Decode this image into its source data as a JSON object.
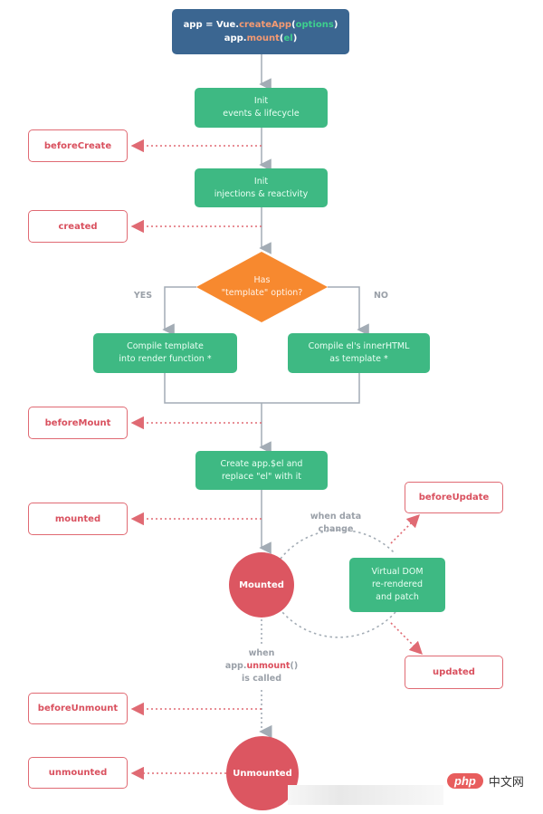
{
  "title": "Vue app lifecycle diagram",
  "colors": {
    "start_box": "#3b6691",
    "process_box": "#3eb983",
    "decision": "#f7892f",
    "hook_border": "#e06a73",
    "hook_text": "#d9505e",
    "state_circle": "#dc5661",
    "flow_line": "#a3acb5",
    "hook_arrow": "#e06a73"
  },
  "start": {
    "line1": {
      "prefix": "app = Vue.",
      "method": "createApp",
      "paren_open": "(",
      "arg": "options",
      "paren_close": ")"
    },
    "line2": {
      "prefix": "app.",
      "method": "mount",
      "paren_open": "(",
      "arg": "el",
      "paren_close": ")"
    }
  },
  "steps": {
    "init_events": [
      "Init",
      "events & lifecycle"
    ],
    "init_injections": [
      "Init",
      "injections & reactivity"
    ],
    "decision": [
      "Has",
      "\"template\" option?"
    ],
    "yes_label": "YES",
    "no_label": "NO",
    "compile_template": [
      "Compile template",
      "into render function *"
    ],
    "compile_el": [
      "Compile el's innerHTML",
      "as template *"
    ],
    "create_el": [
      "Create app.$el and",
      "replace \"el\" with it"
    ],
    "virtual_dom": [
      "Virtual DOM",
      "re-rendered",
      "and patch"
    ]
  },
  "states": {
    "mounted": "Mounted",
    "unmounted": "Unmounted"
  },
  "annotations": {
    "data_change": [
      "when data",
      "change"
    ],
    "unmount_when": "when",
    "unmount_prefix": "app.",
    "unmount_method": "unmount",
    "unmount_parens": "()",
    "unmount_called": "is called"
  },
  "hooks": {
    "beforeCreate": "beforeCreate",
    "created": "created",
    "beforeMount": "beforeMount",
    "mounted": "mounted",
    "beforeUpdate": "beforeUpdate",
    "updated": "updated",
    "beforeUnmount": "beforeUnmount",
    "unmounted": "unmounted"
  },
  "watermark": {
    "brand": "php",
    "site": "中文网"
  }
}
